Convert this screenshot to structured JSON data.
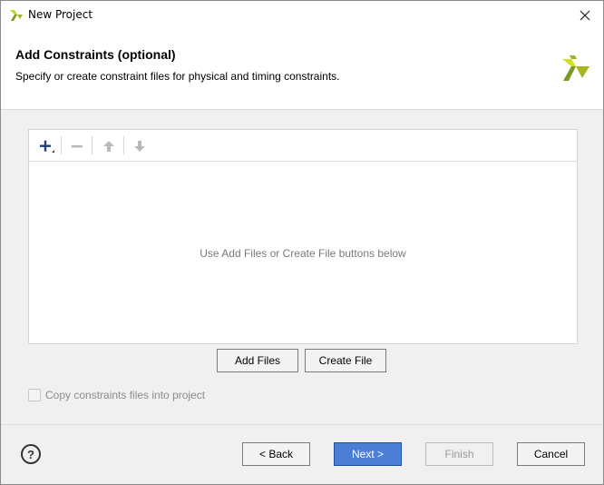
{
  "window": {
    "title": "New Project"
  },
  "header": {
    "title": "Add Constraints (optional)",
    "subtitle": "Specify or create constraint files for physical and timing constraints."
  },
  "file_panel": {
    "toolbar": {
      "add_icon": "plus-icon",
      "remove_icon": "minus-icon",
      "move_up_icon": "arrow-up-icon",
      "move_down_icon": "arrow-down-icon"
    },
    "empty_message": "Use Add Files or Create File buttons below"
  },
  "actions": {
    "add_files_label": "Add Files",
    "create_file_label": "Create File"
  },
  "options": {
    "copy_constraints_label": "Copy constraints files into project",
    "copy_constraints_checked": false
  },
  "footer": {
    "help_label": "?",
    "back_label": "< Back",
    "next_label": "Next >",
    "finish_label": "Finish",
    "cancel_label": "Cancel"
  },
  "colors": {
    "logo_green": "#7a9a1e",
    "logo_yellow": "#d7df23",
    "primary_button": "#4d7ed6"
  }
}
